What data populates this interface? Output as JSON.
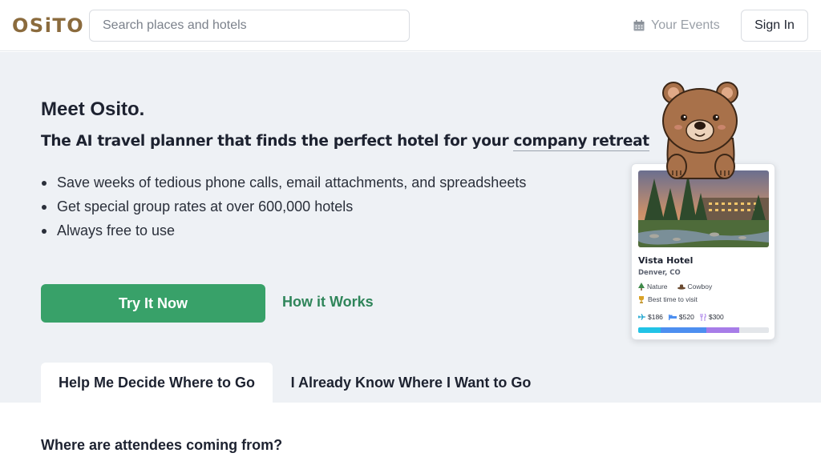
{
  "header": {
    "logo": "OSiTO",
    "search_placeholder": "Search places and hotels",
    "events_label": "Your Events",
    "signin_label": "Sign In"
  },
  "hero": {
    "title": "Meet Osito.",
    "tagline_prefix": "The AI travel planner that finds the perfect hotel for your ",
    "tagline_highlight": "company retreat",
    "bullets": [
      "Save weeks of tedious phone calls, email attachments, and spreadsheets",
      "Get special group rates at over 600,000 hotels",
      "Always free to use"
    ],
    "cta_label": "Try It Now",
    "secondary_link": "How it Works"
  },
  "tabs": [
    {
      "label": "Help Me Decide Where to Go",
      "active": true
    },
    {
      "label": "I Already Know Where I Want to Go",
      "active": false
    }
  ],
  "card": {
    "hotel_name": "Vista Hotel",
    "location": "Denver, CO",
    "tags": [
      "Nature",
      "Cowboy"
    ],
    "best_time": "Best time to visit",
    "prices": {
      "flight": "$186",
      "hotel": "$520",
      "food": "$300"
    },
    "price_share": {
      "flight": 0.17,
      "hotel": 0.35,
      "food": 0.25
    },
    "colors": {
      "flight": "#22c3e6",
      "hotel": "#4d8ff0",
      "food": "#a77de8"
    }
  },
  "form": {
    "question": "Where are attendees coming from?"
  },
  "colors": {
    "primary_green": "#38a169",
    "link_green": "#2f855a",
    "logo_brown": "#8b6b3d",
    "hero_bg": "#eef1f5"
  }
}
